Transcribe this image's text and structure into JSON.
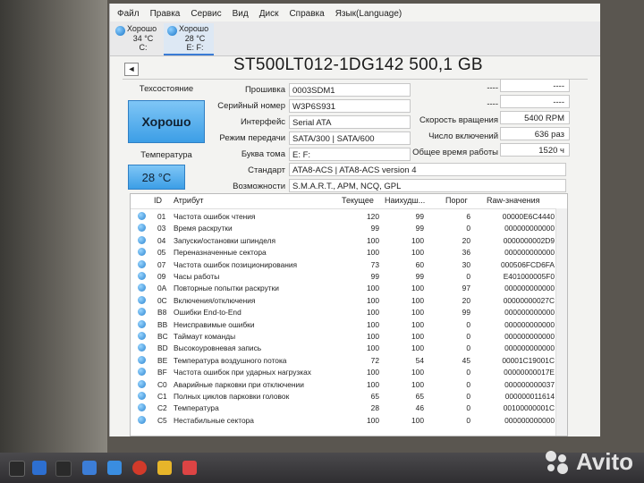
{
  "menu": [
    "Файл",
    "Правка",
    "Сервис",
    "Вид",
    "Диск",
    "Справка",
    "Язык(Language)"
  ],
  "drives": [
    {
      "status": "Хорошо",
      "temp": "34 °C",
      "letter": "C:"
    },
    {
      "status": "Хорошо",
      "temp": "28 °C",
      "letter": "E: F:"
    }
  ],
  "nav_prev": "◄",
  "title": "ST500LT012-1DG142 500,1 GB",
  "health": {
    "label": "Техсостояние",
    "value": "Хорошо",
    "temp_label": "Температура",
    "temp_value": "28 °C"
  },
  "left_fields": [
    {
      "label": "Прошивка",
      "value": "0003SDM1"
    },
    {
      "label": "Серийный номер",
      "value": "W3P6S931"
    },
    {
      "label": "Интерфейс",
      "value": "Serial ATA"
    },
    {
      "label": "Режим передачи",
      "value": "SATA/300 | SATA/600"
    },
    {
      "label": "Буква тома",
      "value": "E: F:"
    }
  ],
  "right_fields": [
    {
      "label": "----",
      "value": "----"
    },
    {
      "label": "----",
      "value": "----"
    },
    {
      "label": "Скорость вращения",
      "value": "5400 RPM"
    },
    {
      "label": "Число включений",
      "value": "636 раз"
    },
    {
      "label": "Общее время работы",
      "value": "1520 ч"
    }
  ],
  "standard": {
    "label": "Стандарт",
    "value": "ATA8-ACS | ATA8-ACS version 4"
  },
  "features": {
    "label": "Возможности",
    "value": "S.M.A.R.T., APM, NCQ, GPL"
  },
  "smart": {
    "columns": [
      "ID",
      "Атрибут",
      "Текущее",
      "Наихудш...",
      "Порог",
      "Raw-значения"
    ],
    "rows": [
      [
        "01",
        "Частота ошибок чтения",
        "120",
        "99",
        "6",
        "00000E6C4440"
      ],
      [
        "03",
        "Время раскрутки",
        "99",
        "99",
        "0",
        "000000000000"
      ],
      [
        "04",
        "Запуски/остановки шпинделя",
        "100",
        "100",
        "20",
        "0000000002D9"
      ],
      [
        "05",
        "Переназначенные сектора",
        "100",
        "100",
        "36",
        "000000000000"
      ],
      [
        "07",
        "Частота ошибок позиционирования",
        "73",
        "60",
        "30",
        "000506FCD6FA"
      ],
      [
        "09",
        "Часы работы",
        "99",
        "99",
        "0",
        "E401000005F0"
      ],
      [
        "0A",
        "Повторные попытки раскрутки",
        "100",
        "100",
        "97",
        "000000000000"
      ],
      [
        "0C",
        "Включения/отключения",
        "100",
        "100",
        "20",
        "00000000027C"
      ],
      [
        "B8",
        "Ошибки End-to-End",
        "100",
        "100",
        "99",
        "000000000000"
      ],
      [
        "BB",
        "Неисправимые ошибки",
        "100",
        "100",
        "0",
        "000000000000"
      ],
      [
        "BC",
        "Таймаут команды",
        "100",
        "100",
        "0",
        "000000000000"
      ],
      [
        "BD",
        "Высокоуровневая запись",
        "100",
        "100",
        "0",
        "000000000000"
      ],
      [
        "BE",
        "Температура воздушного потока",
        "72",
        "54",
        "45",
        "00001C19001C"
      ],
      [
        "BF",
        "Частота ошибок при ударных нагрузках",
        "100",
        "100",
        "0",
        "00000000017E"
      ],
      [
        "C0",
        "Аварийные парковки при отключении",
        "100",
        "100",
        "0",
        "000000000037"
      ],
      [
        "C1",
        "Полных циклов парковки головок",
        "65",
        "65",
        "0",
        "000000011614"
      ],
      [
        "C2",
        "Температура",
        "28",
        "46",
        "0",
        "00100000001C"
      ],
      [
        "C5",
        "Нестабильные сектора",
        "100",
        "100",
        "0",
        "000000000000"
      ]
    ]
  },
  "watermark": "Avito",
  "colors": {
    "accent": "#3c9ee6",
    "status_ok": "#7fc6f6"
  }
}
